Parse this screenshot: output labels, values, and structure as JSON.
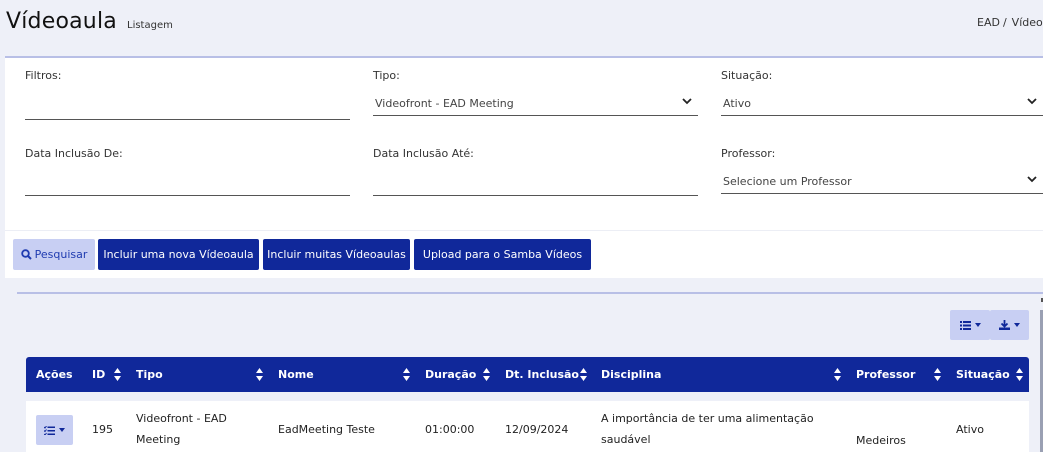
{
  "header": {
    "title": "Vídeoaula",
    "subtitle": "Listagem",
    "breadcrumb": [
      "EAD",
      "Vídeo"
    ],
    "breadcrumb_sep": "/"
  },
  "filters": {
    "filtros": {
      "label": "Filtros:",
      "value": ""
    },
    "tipo": {
      "label": "Tipo:",
      "value": "Videofront - EAD Meeting"
    },
    "situacao": {
      "label": "Situação:",
      "value": "Ativo"
    },
    "data_de": {
      "label": "Data Inclusão De:",
      "value": ""
    },
    "data_ate": {
      "label": "Data Inclusão Até:",
      "value": ""
    },
    "professor": {
      "label": "Professor:",
      "value": "Selecione um Professor"
    }
  },
  "actions": {
    "search": "Pesquisar",
    "new_video": "Incluir uma nova Vídeoaula",
    "many_videos": "Incluir muitas Vídeoaulas",
    "upload": "Upload para o Samba Vídeos"
  },
  "toolbar": {
    "columns_icon": "list-icon",
    "export_icon": "download-icon"
  },
  "table": {
    "columns": [
      "Ações",
      "ID",
      "Tipo",
      "Nome",
      "Duração",
      "Dt. Inclusão",
      "Disciplina",
      "Professor",
      "Situação"
    ],
    "rows": [
      {
        "id": "195",
        "tipo": "Videofront - EAD Meeting",
        "nome": "EadMeeting Teste",
        "duracao": "01:00:00",
        "dt_inclusao": "12/09/2024",
        "disciplina": "A importância de ter uma alimentação saudável",
        "professor": "Medeiros",
        "situacao": "Ativo"
      }
    ]
  },
  "colors": {
    "primary": "#10289a",
    "light": "#c8cff3",
    "background": "#eef0f8"
  }
}
